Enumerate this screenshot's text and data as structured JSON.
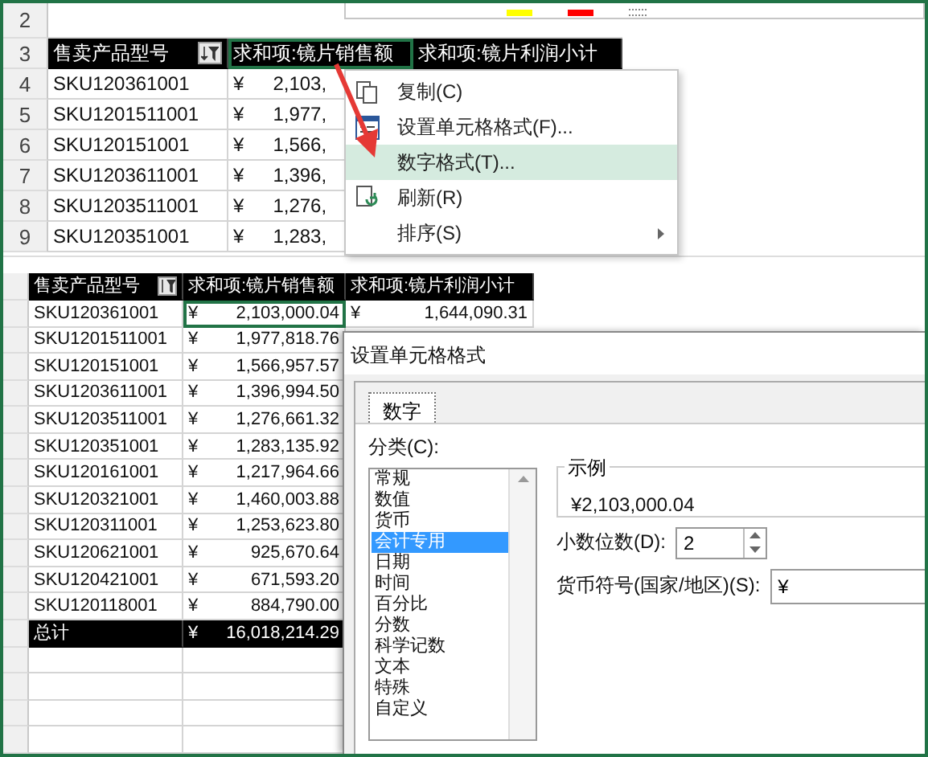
{
  "top_sheet": {
    "row_numbers": [
      "2",
      "3",
      "4",
      "5",
      "6",
      "7",
      "8",
      "9"
    ],
    "header": [
      "售卖产品型号",
      "求和项:镜片销售额",
      "求和项:镜片利润小计"
    ],
    "rows": [
      {
        "model": "SKU120361001",
        "currency": "¥",
        "amount": "2,103,"
      },
      {
        "model": "SKU1201511001",
        "currency": "¥",
        "amount": "1,977,"
      },
      {
        "model": "SKU120151001",
        "currency": "¥",
        "amount": "1,566,"
      },
      {
        "model": "SKU1203611001",
        "currency": "¥",
        "amount": "1,396,"
      },
      {
        "model": "SKU1203511001",
        "currency": "¥",
        "amount": "1,276,"
      },
      {
        "model": "SKU120351001",
        "currency": "¥",
        "amount": "1,283,"
      }
    ]
  },
  "context_menu": {
    "items": [
      {
        "label": "复制(C)",
        "selected": false,
        "submenu": false
      },
      {
        "label": "设置单元格格式(F)...",
        "selected": false,
        "submenu": false
      },
      {
        "label": "数字格式(T)...",
        "selected": true,
        "submenu": false
      },
      {
        "label": "刷新(R)",
        "selected": false,
        "submenu": false
      },
      {
        "label": "排序(S)",
        "selected": false,
        "submenu": true
      }
    ]
  },
  "bottom_sheet": {
    "header": [
      "售卖产品型号",
      "求和项:镜片销售额",
      "求和项:镜片利润小计"
    ],
    "first_row_profit": {
      "currency": "¥",
      "amount": "1,644,090.31"
    },
    "rows": [
      {
        "kind": "data",
        "model": "SKU120361001",
        "currency": "¥",
        "amount": "2,103,000.04"
      },
      {
        "kind": "data",
        "model": "SKU1201511001",
        "currency": "¥",
        "amount": "1,977,818.76"
      },
      {
        "kind": "data",
        "model": "SKU120151001",
        "currency": "¥",
        "amount": "1,566,957.57"
      },
      {
        "kind": "data",
        "model": "SKU1203611001",
        "currency": "¥",
        "amount": "1,396,994.50"
      },
      {
        "kind": "data",
        "model": "SKU1203511001",
        "currency": "¥",
        "amount": "1,276,661.32"
      },
      {
        "kind": "data",
        "model": "SKU120351001",
        "currency": "¥",
        "amount": "1,283,135.92"
      },
      {
        "kind": "data",
        "model": "SKU120161001",
        "currency": "¥",
        "amount": "1,217,964.66"
      },
      {
        "kind": "data",
        "model": "SKU120321001",
        "currency": "¥",
        "amount": "1,460,003.88"
      },
      {
        "kind": "data",
        "model": "SKU120311001",
        "currency": "¥",
        "amount": "1,253,623.80"
      },
      {
        "kind": "data",
        "model": "SKU120621001",
        "currency": "¥",
        "amount": "925,670.64"
      },
      {
        "kind": "data",
        "model": "SKU120421001",
        "currency": "¥",
        "amount": "671,593.20"
      },
      {
        "kind": "data",
        "model": "SKU120118001",
        "currency": "¥",
        "amount": "884,790.00"
      },
      {
        "kind": "total",
        "model": "总计",
        "currency": "¥",
        "amount": "16,018,214.29"
      }
    ]
  },
  "format_dialog": {
    "title": "设置单元格格式",
    "tabs": [
      {
        "label": "数字",
        "selected": true
      }
    ],
    "category_label": "分类(C):",
    "categories": [
      {
        "label": "常规",
        "selected": false
      },
      {
        "label": "数值",
        "selected": false
      },
      {
        "label": "货币",
        "selected": false
      },
      {
        "label": "会计专用",
        "selected": true
      },
      {
        "label": "日期",
        "selected": false
      },
      {
        "label": "时间",
        "selected": false
      },
      {
        "label": "百分比",
        "selected": false
      },
      {
        "label": "分数",
        "selected": false
      },
      {
        "label": "科学记数",
        "selected": false
      },
      {
        "label": "文本",
        "selected": false
      },
      {
        "label": "特殊",
        "selected": false
      },
      {
        "label": "自定义",
        "selected": false
      }
    ],
    "sample_label": "示例",
    "sample_value": "¥2,103,000.04",
    "decimal_label": "小数位数(D):",
    "decimal_value": "2",
    "currency_label": "货币符号(国家/地区)(S):",
    "currency_value": "¥"
  }
}
